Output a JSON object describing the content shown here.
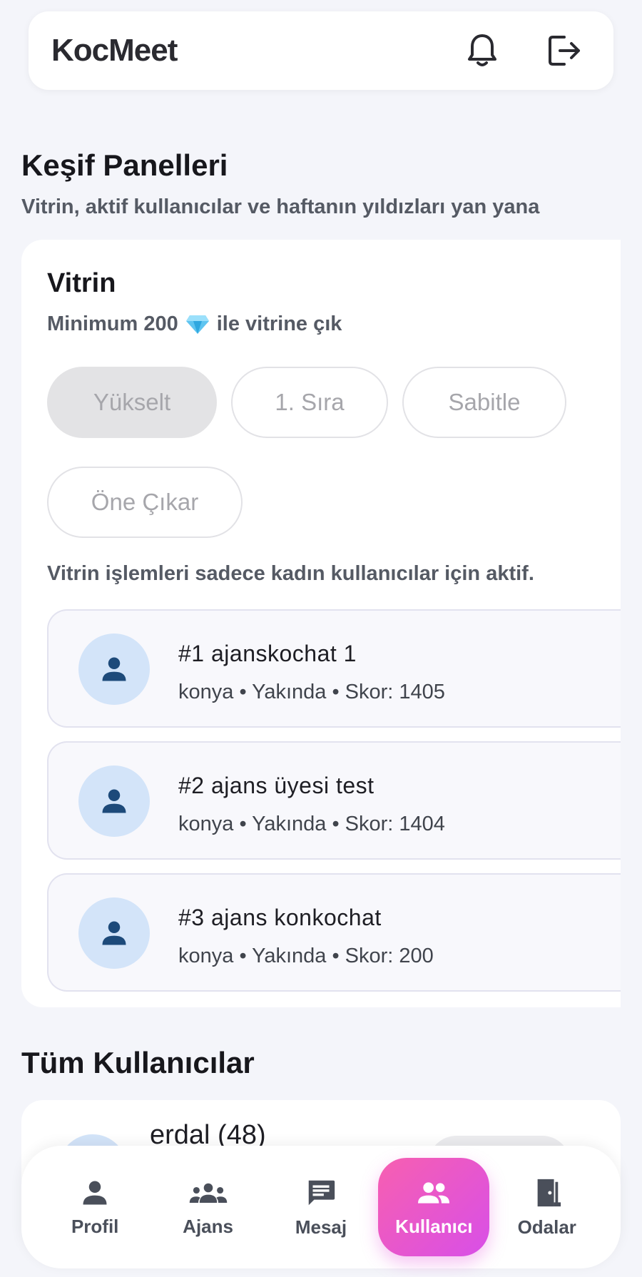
{
  "app": {
    "title": "KocMeet"
  },
  "discover": {
    "title": "Keşif Panelleri",
    "subtitle": "Vitrin, aktif kullanıcılar ve haftanın yıldızları yan yana"
  },
  "vitrin": {
    "title": "Vitrin",
    "subtitle_prefix": "Minimum 200",
    "subtitle_suffix": "ile vitrine çık",
    "actions": [
      "Yükselt",
      "1. Sıra",
      "Sabitle",
      "Öne Çıkar"
    ],
    "note": "Vitrin işlemleri sadece kadın kullanıcılar için aktif.",
    "entries": [
      {
        "name": "#1 ajanskochat 1",
        "meta": "konya • Yakında • Skor: 1405"
      },
      {
        "name": "#2 ajans üyesi test",
        "meta": "konya • Yakında • Skor: 1404"
      },
      {
        "name": "#3 ajans konkochat",
        "meta": "konya • Yakında • Skor: 200"
      }
    ]
  },
  "all_users": {
    "title": "Tüm Kullanıcılar",
    "first_user": "erdal (48)"
  },
  "nav": {
    "items": [
      {
        "label": "Profil",
        "icon": "person-icon"
      },
      {
        "label": "Ajans",
        "icon": "group-icon"
      },
      {
        "label": "Mesaj",
        "icon": "message-icon"
      },
      {
        "label": "Kullanıcı",
        "icon": "people-icon",
        "active": true
      },
      {
        "label": "Odalar",
        "icon": "door-icon"
      }
    ]
  },
  "colors": {
    "accent_start": "#f75fb0",
    "accent_end": "#d84fe8",
    "avatar_bg": "#d3e4f9",
    "avatar_icon": "#1d4a7a"
  }
}
